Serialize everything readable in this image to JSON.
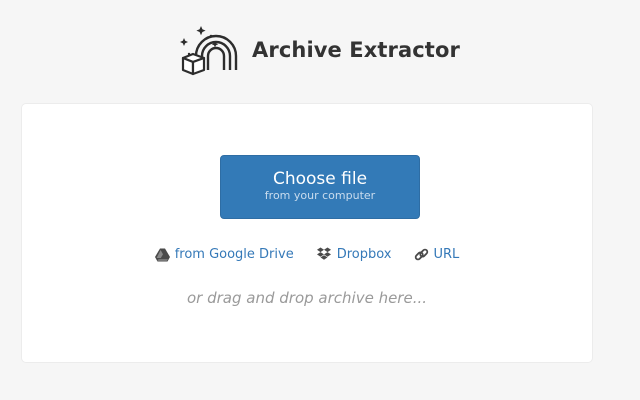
{
  "header": {
    "app_title": "Archive Extractor",
    "logo_icon": "rainbow-box-logo-icon"
  },
  "main": {
    "choose_file": {
      "label": "Choose file",
      "sublabel": "from your computer",
      "color": "#337ab7"
    },
    "sources": [
      {
        "label": "from Google Drive",
        "icon": "google-drive-icon"
      },
      {
        "label": "Dropbox",
        "icon": "dropbox-icon"
      },
      {
        "label": "URL",
        "icon": "link-icon"
      }
    ],
    "drop_hint": "or drag and drop archive here..."
  }
}
